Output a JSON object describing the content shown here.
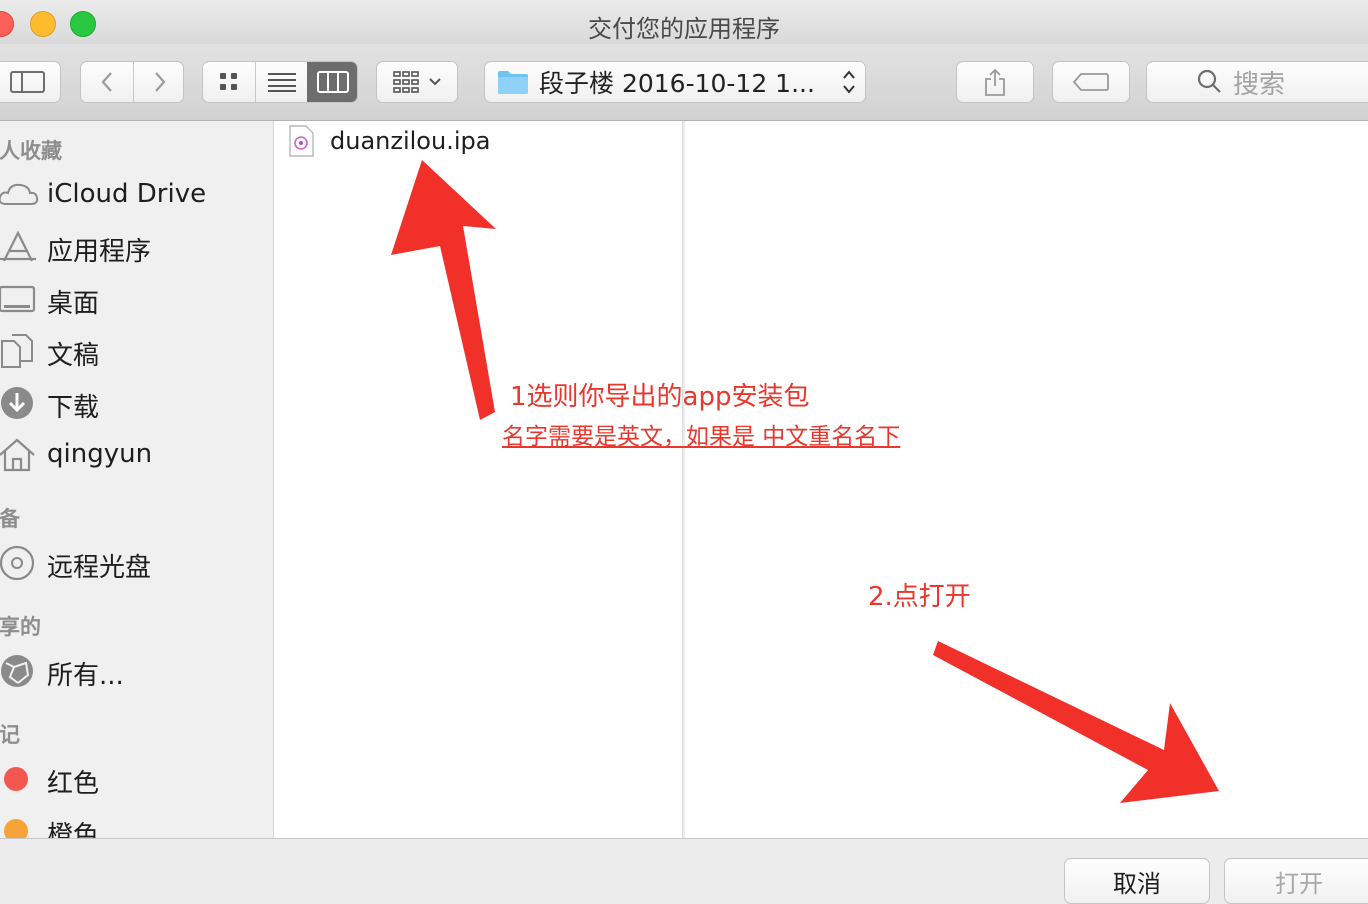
{
  "window": {
    "title": "交付您的应用程序"
  },
  "toolbar": {
    "view_modes": [
      "icon-view",
      "list-view",
      "column-view"
    ],
    "active_view": "column-view",
    "path": "段子楼 2016-10-12 1...",
    "search_placeholder": "搜索"
  },
  "sidebar": {
    "favorites_header": "个人收藏",
    "favorites": [
      {
        "label": "iCloud Drive",
        "icon": "cloud-icon"
      },
      {
        "label": "应用程序",
        "icon": "applications-icon"
      },
      {
        "label": "桌面",
        "icon": "desktop-icon"
      },
      {
        "label": "文稿",
        "icon": "documents-icon"
      },
      {
        "label": "下载",
        "icon": "downloads-icon"
      },
      {
        "label": "qingyun",
        "icon": "home-icon"
      }
    ],
    "devices_header": "设备",
    "devices": [
      {
        "label": "远程光盘",
        "icon": "disc-icon"
      }
    ],
    "shared_header": "共享的",
    "shared": [
      {
        "label": "所有...",
        "icon": "network-icon"
      }
    ],
    "tags_header": "标记",
    "tags": [
      {
        "label": "红色",
        "color": "#f2584f"
      },
      {
        "label": "橙色",
        "color": "#f6a33a"
      }
    ]
  },
  "files": [
    {
      "name": "duanzilou.ipa",
      "icon": "ipa-file-icon"
    }
  ],
  "annotations": {
    "step1_line1": "1选则你导出的app安装包",
    "step1_line2": "名字需要是英文，如果是 中文重名名下",
    "step2": "2.点打开"
  },
  "buttons": {
    "cancel": "取消",
    "open": "打开"
  }
}
